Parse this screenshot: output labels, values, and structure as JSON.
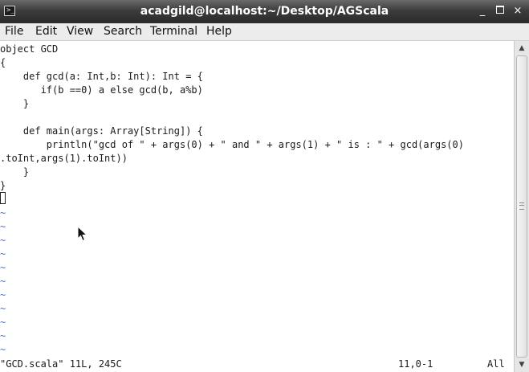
{
  "window": {
    "title": "acadgild@localhost:~/Desktop/AGScala",
    "icon": "terminal-icon",
    "controls": {
      "minimize": "_",
      "close": "×"
    }
  },
  "menu": {
    "items": [
      {
        "label": "File"
      },
      {
        "label": "Edit"
      },
      {
        "label": "View"
      },
      {
        "label": "Search"
      },
      {
        "label": "Terminal"
      },
      {
        "label": "Help"
      }
    ]
  },
  "editor": {
    "lines": [
      "object GCD",
      "{",
      "    def gcd(a: Int,b: Int): Int = {",
      "       if(b ==0) a else gcd(b, a%b)",
      "    }",
      "",
      "    def main(args: Array[String]) {",
      "        println(\"gcd of \" + args(0) + \" and \" + args(1) + \" is : \" + gcd(args(0)",
      ".toInt,args(1).toInt))",
      "    }",
      "}"
    ],
    "tilde": "~",
    "tilde_count": 11
  },
  "status": {
    "file_info": "\"GCD.scala\" 11L, 245C",
    "position": "11,0-1",
    "scroll": "All"
  },
  "colors": {
    "tilde": "#4f6fd6",
    "titlebar": "#3c3c3c",
    "menubar": "#ececec"
  }
}
